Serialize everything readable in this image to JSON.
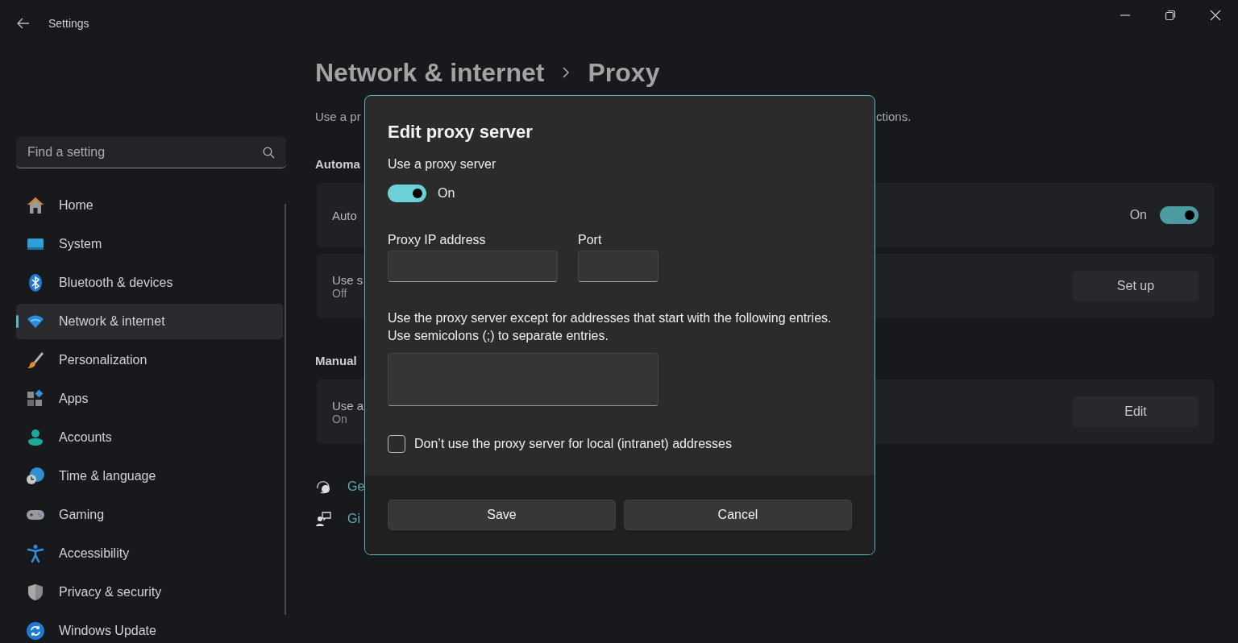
{
  "window": {
    "title": "Settings"
  },
  "sidebar": {
    "search": {
      "placeholder": "Find a setting"
    },
    "items": [
      {
        "label": "Home",
        "selected": false
      },
      {
        "label": "System",
        "selected": false
      },
      {
        "label": "Bluetooth & devices",
        "selected": false
      },
      {
        "label": "Network & internet",
        "selected": true
      },
      {
        "label": "Personalization",
        "selected": false
      },
      {
        "label": "Apps",
        "selected": false
      },
      {
        "label": "Accounts",
        "selected": false
      },
      {
        "label": "Time & language",
        "selected": false
      },
      {
        "label": "Gaming",
        "selected": false
      },
      {
        "label": "Accessibility",
        "selected": false
      },
      {
        "label": "Privacy & security",
        "selected": false
      },
      {
        "label": "Windows Update",
        "selected": false
      }
    ]
  },
  "page": {
    "breadcrumb": [
      "Network & internet",
      "Proxy"
    ],
    "description": {
      "start": "Use a pr",
      "end": "ctions."
    },
    "sections": [
      {
        "header": "Automa",
        "cards": [
          {
            "kind": "toggle",
            "title": "Auto",
            "state_text": "On",
            "on": true
          },
          {
            "kind": "button",
            "title": "Use s",
            "subtitle": "Off",
            "button": "Set up"
          }
        ]
      },
      {
        "header": "Manual",
        "cards": [
          {
            "kind": "button",
            "title": "Use a",
            "subtitle": "On",
            "button": "Edit"
          }
        ]
      }
    ],
    "links": [
      {
        "kind": "help",
        "text": "Ge"
      },
      {
        "kind": "feedback",
        "text": "Gi"
      }
    ]
  },
  "dialog": {
    "title": "Edit proxy server",
    "proxy_toggle": {
      "label": "Use a proxy server",
      "on": true,
      "state_text": "On"
    },
    "fields": [
      {
        "label": "Proxy IP address"
      },
      {
        "label": "Port"
      }
    ],
    "exceptions": {
      "lines": [
        "Use the proxy server except for addresses that start with the following entries.",
        "Use semicolons (;) to separate entries."
      ]
    },
    "local_checkbox": {
      "label": "Don’t use the proxy server for local (intranet) addresses",
      "checked": false
    },
    "buttons": [
      "Save",
      "Cancel"
    ]
  }
}
